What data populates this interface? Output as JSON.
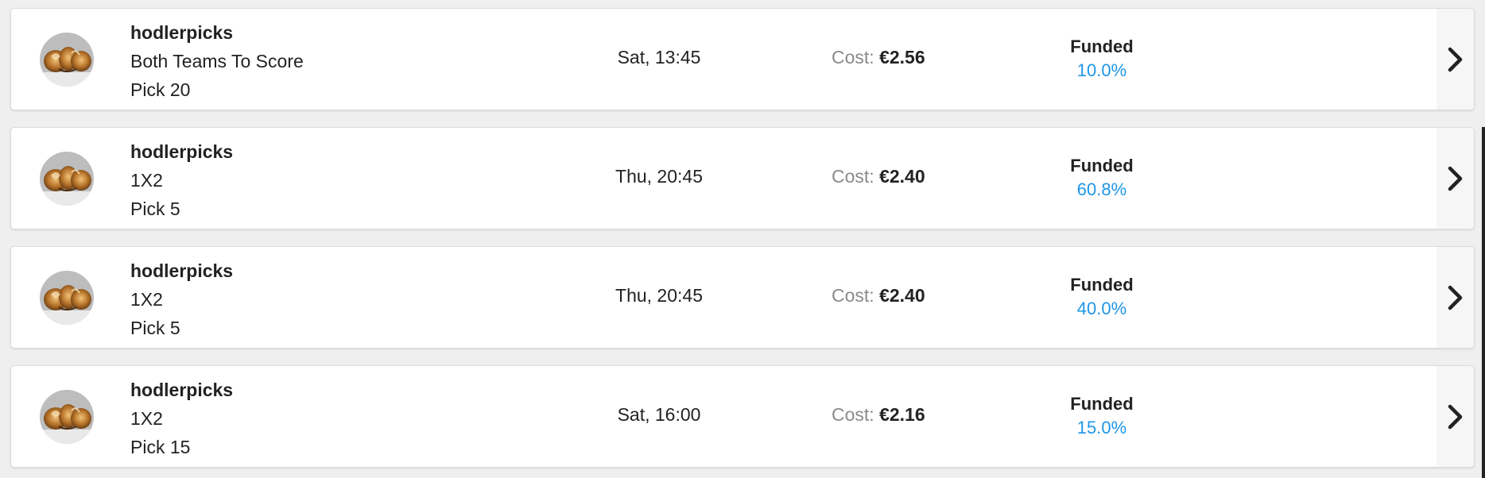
{
  "colors": {
    "accent": "#1e96e8",
    "cost_label": "#8a8a8a",
    "text": "#222222"
  },
  "icons": {
    "avatar": "tipster-avatar-icon",
    "row_arrow": "chevron-right-icon"
  },
  "picks": [
    {
      "tipster": "hodlerpicks",
      "market": "Both Teams To Score",
      "pick": "Pick 20",
      "time": "Sat, 13:45",
      "cost_label": "Cost:",
      "cost_value": "€2.56",
      "funded_label": "Funded",
      "funded_pct": "10.0%",
      "funded_fraction": 0.1
    },
    {
      "tipster": "hodlerpicks",
      "market": "1X2",
      "pick": "Pick 5",
      "time": "Thu, 20:45",
      "cost_label": "Cost:",
      "cost_value": "€2.40",
      "funded_label": "Funded",
      "funded_pct": "60.8%",
      "funded_fraction": 0.608
    },
    {
      "tipster": "hodlerpicks",
      "market": "1X2",
      "pick": "Pick 5",
      "time": "Thu, 20:45",
      "cost_label": "Cost:",
      "cost_value": "€2.40",
      "funded_label": "Funded",
      "funded_pct": "40.0%",
      "funded_fraction": 0.4
    },
    {
      "tipster": "hodlerpicks",
      "market": "1X2",
      "pick": "Pick 15",
      "time": "Sat, 16:00",
      "cost_label": "Cost:",
      "cost_value": "€2.16",
      "funded_label": "Funded",
      "funded_pct": "15.0%",
      "funded_fraction": 0.15
    }
  ]
}
